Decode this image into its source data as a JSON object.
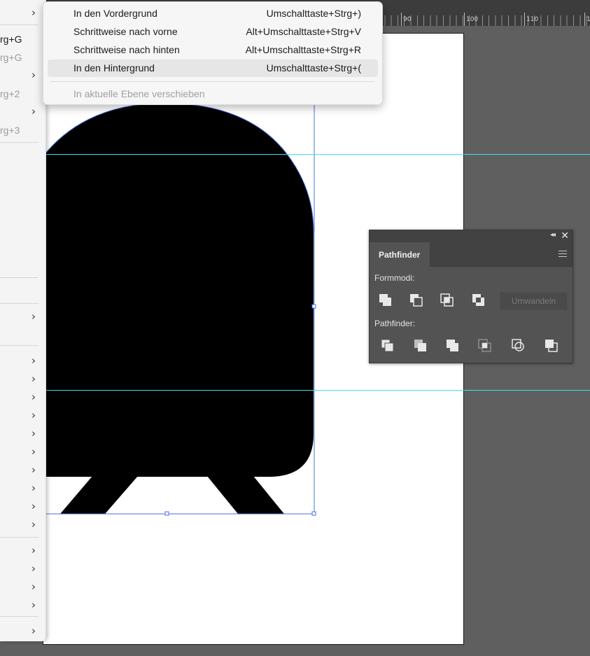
{
  "ruler": {
    "labels": [
      "90",
      "100",
      "110",
      "1"
    ]
  },
  "left_menu": {
    "items": [
      {
        "text": "",
        "submenu": true
      },
      {
        "text": "rg+G",
        "dim": false
      },
      {
        "text": "rg+G",
        "dim": true
      },
      {
        "text": "",
        "submenu": true
      },
      {
        "text": "rg+2",
        "dim": true
      },
      {
        "text": "",
        "submenu": true
      },
      {
        "text": "rg+3",
        "dim": true
      }
    ]
  },
  "arrange_submenu": {
    "items": [
      {
        "label": "In den Vordergrund",
        "shortcut": "Umschalttaste+Strg+)"
      },
      {
        "label": "Schrittweise nach vorne",
        "shortcut": "Alt+Umschalttaste+Strg+V"
      },
      {
        "label": "Schrittweise nach hinten",
        "shortcut": "Alt+Umschalttaste+Strg+R"
      },
      {
        "label": "In den Hintergrund",
        "shortcut": "Umschalttaste+Strg+("
      },
      {
        "label": "In aktuelle Ebene verschieben",
        "shortcut": ""
      }
    ],
    "highlighted_index": 3
  },
  "pathfinder": {
    "tab_label": "Pathfinder",
    "shape_modes_label": "Formmodi:",
    "pathfinders_label": "Pathfinder:",
    "expand_label": "Umwandeln",
    "shape_mode_icons": [
      "unite-icon",
      "minus-front-icon",
      "intersect-icon",
      "exclude-icon"
    ],
    "pathfinder_icons": [
      "divide-icon",
      "trim-icon",
      "merge-icon",
      "crop-icon",
      "outline-icon",
      "minus-back-icon"
    ]
  },
  "colors": {
    "artboard_bg": "#ffffff",
    "canvas_bg": "#5f5f5f",
    "guide": "#41e0ec",
    "selection": "#4a6fe0",
    "shape_fill": "#000000",
    "menu_bg": "#f6f6f6",
    "panel_bg": "#535353"
  }
}
